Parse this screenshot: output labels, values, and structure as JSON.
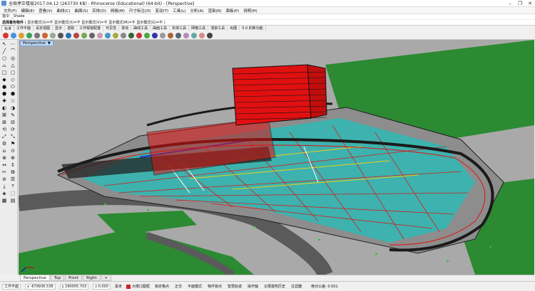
{
  "window": {
    "title": "全局停正楼层2017.04.12 (263730 KB) - Rhinoceros (Educational) (64-bit) - [Perspective]",
    "min_glyph": "–",
    "max_glyph": "❐",
    "close_glyph": "✕"
  },
  "menu": [
    "文件(F)",
    "编辑(E)",
    "查看(V)",
    "曲线(C)",
    "曲面(S)",
    "实体(O)",
    "网格(M)",
    "尺寸标注(D)",
    "变动(T)",
    "工具(L)",
    "分析(A)",
    "渲染(R)",
    "面板(P)",
    "说明(H)"
  ],
  "command": {
    "history": "指令: _Shade",
    "prompt": "选择着色物件",
    "options": "( 显示模式(S)=不 显示模式(X)=不 显示模式(V)=不 显示模式(M)=不 显示模式(G)=不 )"
  },
  "toolbar_tabs": [
    {
      "label": "标准",
      "active": true
    },
    {
      "label": "工作平面"
    },
    {
      "label": "设定视图"
    },
    {
      "label": "显示"
    },
    {
      "label": "选取"
    },
    {
      "label": "工作视窗配置"
    },
    {
      "label": "可见性"
    },
    {
      "label": "变动"
    },
    {
      "label": "曲线工具"
    },
    {
      "label": "曲面工具"
    },
    {
      "label": "实体工具"
    },
    {
      "label": "网格工具"
    },
    {
      "label": "渲染工具"
    },
    {
      "label": "出图"
    },
    {
      "label": "5.0 的新功能"
    }
  ],
  "toolbar_icons": [
    "#d33",
    "#4a90d9",
    "#d9a03a",
    "#3aa05a",
    "#777",
    "#c63",
    "#9a9",
    "#555",
    "#2c6fb5",
    "#b44",
    "#7a5",
    "#666",
    "#c9a",
    "#49c",
    "#aa4",
    "#888",
    "#363",
    "#c33",
    "#4a4",
    "#33a",
    "#999",
    "#a63",
    "#567",
    "#b8b",
    "#6aa",
    "#d88",
    "#444"
  ],
  "left_tools": [
    "↖",
    "⋯",
    "╱",
    "⌒",
    "○",
    "◎",
    "⌓",
    "△",
    "□",
    "▢",
    "◆",
    "◇",
    "●",
    "⬭",
    "⬟",
    "⬢",
    "✚",
    "⤫",
    "◐",
    "◑",
    "⌘",
    "✎",
    "⊞",
    "⊟",
    "⟲",
    "⟳",
    "⤢",
    "⤡",
    "⚙",
    "⚑",
    "⌂",
    "⊙",
    "⊗",
    "⊕",
    "↔",
    "↕",
    "✂",
    "⧉",
    "⊘",
    "☰",
    "⤓",
    "⤒",
    "◈",
    "⬚",
    "▦",
    "▤"
  ],
  "viewport": {
    "label": "Perspective",
    "menu_caret": "▼",
    "colors": {
      "ground": "#a9a9a9",
      "grass": "#2c8a32",
      "road": "#5a5a5a",
      "structure_red": "#e01010",
      "structure_teal": "#2fb9b4",
      "wire_dark": "#1a1a1a"
    }
  },
  "view_tabs": [
    {
      "label": "Perspective",
      "active": true
    },
    {
      "label": "Top"
    },
    {
      "label": "Front"
    },
    {
      "label": "Right"
    },
    {
      "label": "+"
    }
  ],
  "status": {
    "cplane": "工作平面",
    "x": "x -679936.538",
    "y": "y 290005.703",
    "z": "z 0.000",
    "units": "毫米",
    "layer": "大楼口图框",
    "toggles": [
      "锁定格点",
      "正交",
      "平面模式",
      "物件锁点",
      "智慧轨迹",
      "操作轴",
      "记录建构历史",
      "过滤器"
    ],
    "tolerance": "绝对公差: 0.001"
  }
}
